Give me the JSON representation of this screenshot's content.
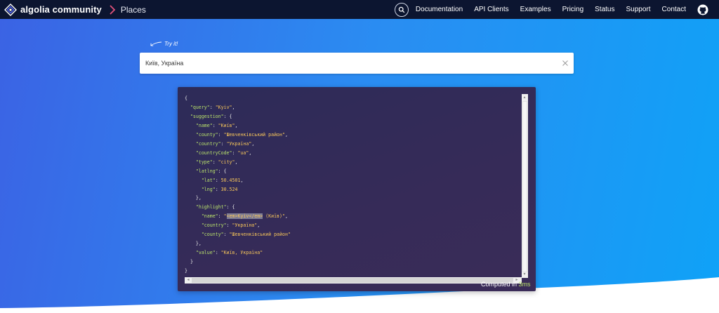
{
  "nav": {
    "brand_name": "algolia community",
    "section": "Places",
    "links": [
      "Documentation",
      "API Clients",
      "Examples",
      "Pricing",
      "Status",
      "Support",
      "Contact"
    ],
    "icons": {
      "logo": "algolia-logo-icon",
      "separator": "chevron-right-icon",
      "search": "search-icon",
      "github": "github-icon"
    },
    "accent_color": "#e2527b"
  },
  "try_it": {
    "label": "Try it!"
  },
  "search": {
    "value": "Київ, Україна",
    "clear_icon": "close-icon"
  },
  "result": {
    "json_lines": [
      [
        [
          "p",
          "{"
        ]
      ],
      [
        [
          "p",
          "  "
        ],
        [
          "k",
          "\"query\""
        ],
        [
          "p",
          ": "
        ],
        [
          "s",
          "\"Kyiv\""
        ],
        [
          "p",
          ","
        ]
      ],
      [
        [
          "p",
          "  "
        ],
        [
          "k",
          "\"suggestion\""
        ],
        [
          "p",
          ": {"
        ]
      ],
      [
        [
          "p",
          "    "
        ],
        [
          "k",
          "\"name\""
        ],
        [
          "p",
          ": "
        ],
        [
          "s",
          "\"Київ\""
        ],
        [
          "p",
          ","
        ]
      ],
      [
        [
          "p",
          "    "
        ],
        [
          "k",
          "\"county\""
        ],
        [
          "p",
          ": "
        ],
        [
          "s",
          "\"Шевченківський район\""
        ],
        [
          "p",
          ","
        ]
      ],
      [
        [
          "p",
          "    "
        ],
        [
          "k",
          "\"country\""
        ],
        [
          "p",
          ": "
        ],
        [
          "s",
          "\"Україна\""
        ],
        [
          "p",
          ","
        ]
      ],
      [
        [
          "p",
          "    "
        ],
        [
          "k",
          "\"countryCode\""
        ],
        [
          "p",
          ": "
        ],
        [
          "s",
          "\"ua\""
        ],
        [
          "p",
          ","
        ]
      ],
      [
        [
          "p",
          "    "
        ],
        [
          "k",
          "\"type\""
        ],
        [
          "p",
          ": "
        ],
        [
          "s",
          "\"city\""
        ],
        [
          "p",
          ","
        ]
      ],
      [
        [
          "p",
          "    "
        ],
        [
          "k",
          "\"latlng\""
        ],
        [
          "p",
          ": {"
        ]
      ],
      [
        [
          "p",
          "      "
        ],
        [
          "k",
          "\"lat\""
        ],
        [
          "p",
          ": "
        ],
        [
          "n",
          "50.4501"
        ],
        [
          "p",
          ","
        ]
      ],
      [
        [
          "p",
          "      "
        ],
        [
          "k",
          "\"lng\""
        ],
        [
          "p",
          ": "
        ],
        [
          "n",
          "30.524"
        ]
      ],
      [
        [
          "p",
          "    },"
        ]
      ],
      [
        [
          "p",
          "    "
        ],
        [
          "k",
          "\"highlight\""
        ],
        [
          "p",
          ": {"
        ]
      ],
      [
        [
          "p",
          "      "
        ],
        [
          "k",
          "\"name\""
        ],
        [
          "p",
          ": "
        ],
        [
          "s",
          "\""
        ],
        [
          "h",
          "<em>Kyiv</em>"
        ],
        [
          "s",
          " (Київ)\""
        ],
        [
          "p",
          ","
        ]
      ],
      [
        [
          "p",
          "      "
        ],
        [
          "k",
          "\"country\""
        ],
        [
          "p",
          ": "
        ],
        [
          "s",
          "\"Україна\""
        ],
        [
          "p",
          ","
        ]
      ],
      [
        [
          "p",
          "      "
        ],
        [
          "k",
          "\"county\""
        ],
        [
          "p",
          ": "
        ],
        [
          "s",
          "\"Шевченківський район\""
        ]
      ],
      [
        [
          "p",
          "    },"
        ]
      ],
      [
        [
          "p",
          "    "
        ],
        [
          "k",
          "\"value\""
        ],
        [
          "p",
          ": "
        ],
        [
          "s",
          "\"Київ, Україна\""
        ]
      ],
      [
        [
          "p",
          "  }"
        ]
      ],
      [
        [
          "p",
          "}"
        ]
      ]
    ],
    "computed_prefix": "Computed in ",
    "computed_ms": "3ms",
    "colors": {
      "key": "#b8e06b",
      "string": "#f6c55a",
      "panel": "#2f2b58"
    }
  }
}
